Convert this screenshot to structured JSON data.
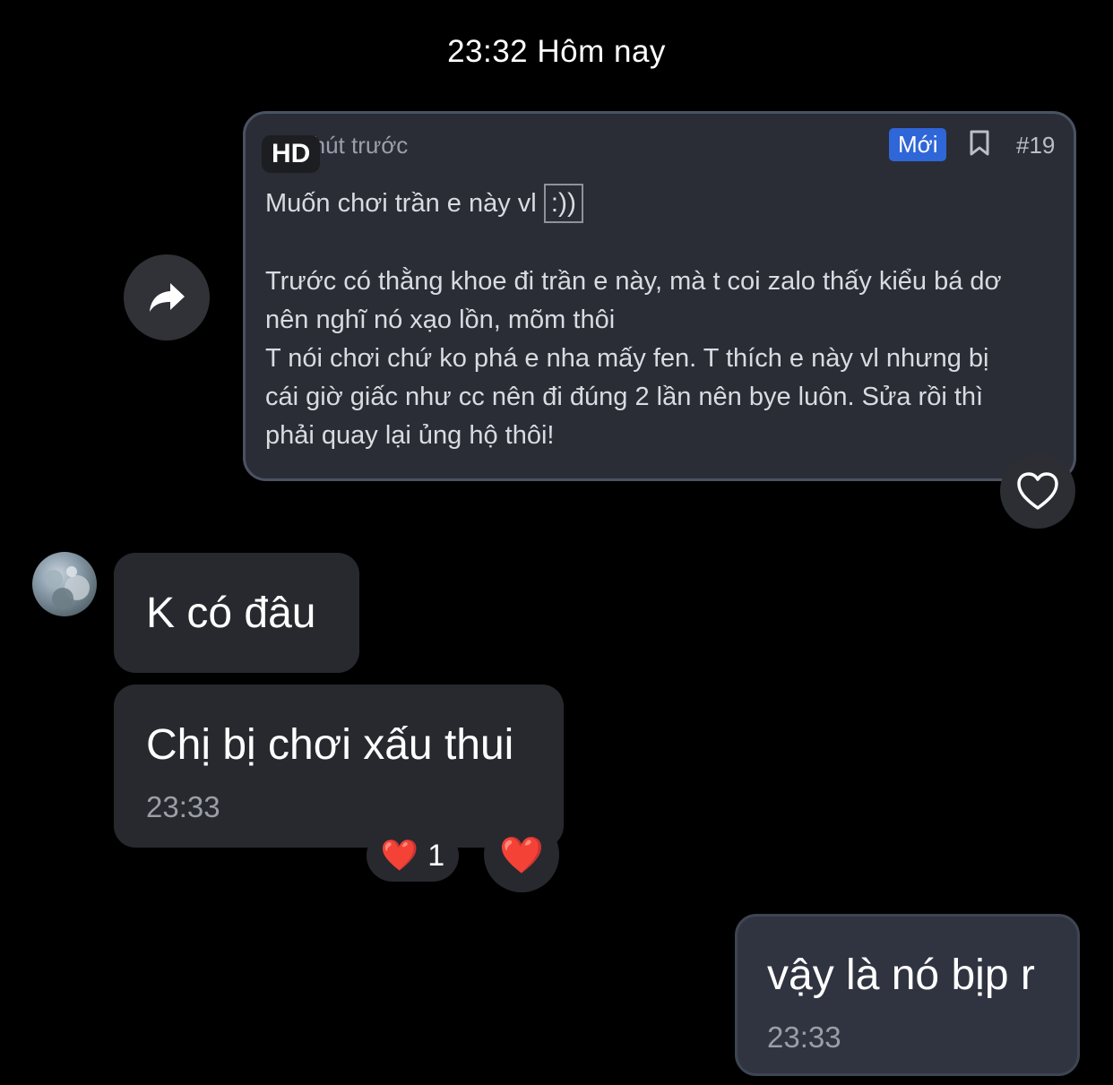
{
  "date_separator": "23:32 Hôm nay",
  "shared_post": {
    "time_ago": "32 phút trước",
    "hd_badge": "HD",
    "new_badge": "Mới",
    "post_number": "#19",
    "first_line": "Muốn chơi trần e này vl",
    "emoticon": ":))",
    "paragraph_lines": [
      "Trước có thằng khoe đi trần e này, mà t coi zalo thấy kiểu bá dơ",
      "nên nghĩ nó xạo lồn, mõm thôi",
      "T nói chơi chứ ko phá e nha mấy fen. T thích e này vl nhưng bị",
      "cái giờ giấc như cc nên đi đúng 2 lần nên bye luôn. Sửa rồi thì",
      "phải quay lại ủng hộ thôi!"
    ]
  },
  "messages": [
    {
      "text": "K có đâu",
      "time": ""
    },
    {
      "text": "Chị bị chơi xấu thui",
      "time": "23:33",
      "reaction": "❤️",
      "reaction_count": "1"
    },
    {
      "text": "vậy là nó bịp r",
      "time": "23:33"
    }
  ],
  "reaction_button_emoji": "❤️",
  "icons": {
    "forward": "forward-arrow-icon",
    "heart": "heart-outline-icon",
    "bookmark": "bookmark-icon"
  },
  "colors": {
    "background": "#000000",
    "received_bubble": "#27292e",
    "sent_bubble": "#2f3440",
    "new_badge": "#2f66d8"
  }
}
